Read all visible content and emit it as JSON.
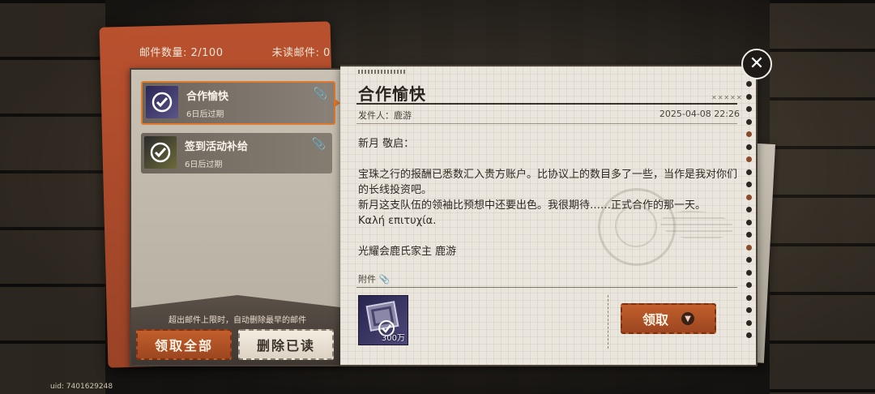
{
  "stats": {
    "mail_count": "邮件数量: 2/100",
    "unread": "未读邮件: 0"
  },
  "mail_list": [
    {
      "title": "合作愉快",
      "expiry": "6日后过期",
      "selected": true
    },
    {
      "title": "签到活动补给",
      "expiry": "6日后过期",
      "selected": false
    }
  ],
  "left_footer": {
    "limit_note": "超出邮件上限时，自动删除最早的邮件",
    "claim_all": "领取全部",
    "delete_read": "删除已读"
  },
  "letter": {
    "title": "合作愉快",
    "sender": "发件人：鹿游",
    "date": "2025-04-08 22:26",
    "lines": [
      "新月 敬启：",
      "",
      "宝珠之行的报酬已悉数汇入贵方账户。比协议上的数目多了一些，当作是我对你们的长线投资吧。",
      "新月这支队伍的领袖比预想中还要出色。我很期待……正式合作的那一天。",
      "Καλή επιτυχία.",
      "",
      "光耀会鹿氏家主 鹿游"
    ],
    "attachment_label": "附件",
    "attachment_qty": "300万",
    "claim": "领取"
  },
  "uid": "uid: 7401629248",
  "icons": {
    "close": "close-icon",
    "clip": "paperclip-icon",
    "claim_arrow": "down-arrow-icon"
  },
  "colors": {
    "accent": "#c25f2c",
    "selected_border": "#e27a2c"
  }
}
